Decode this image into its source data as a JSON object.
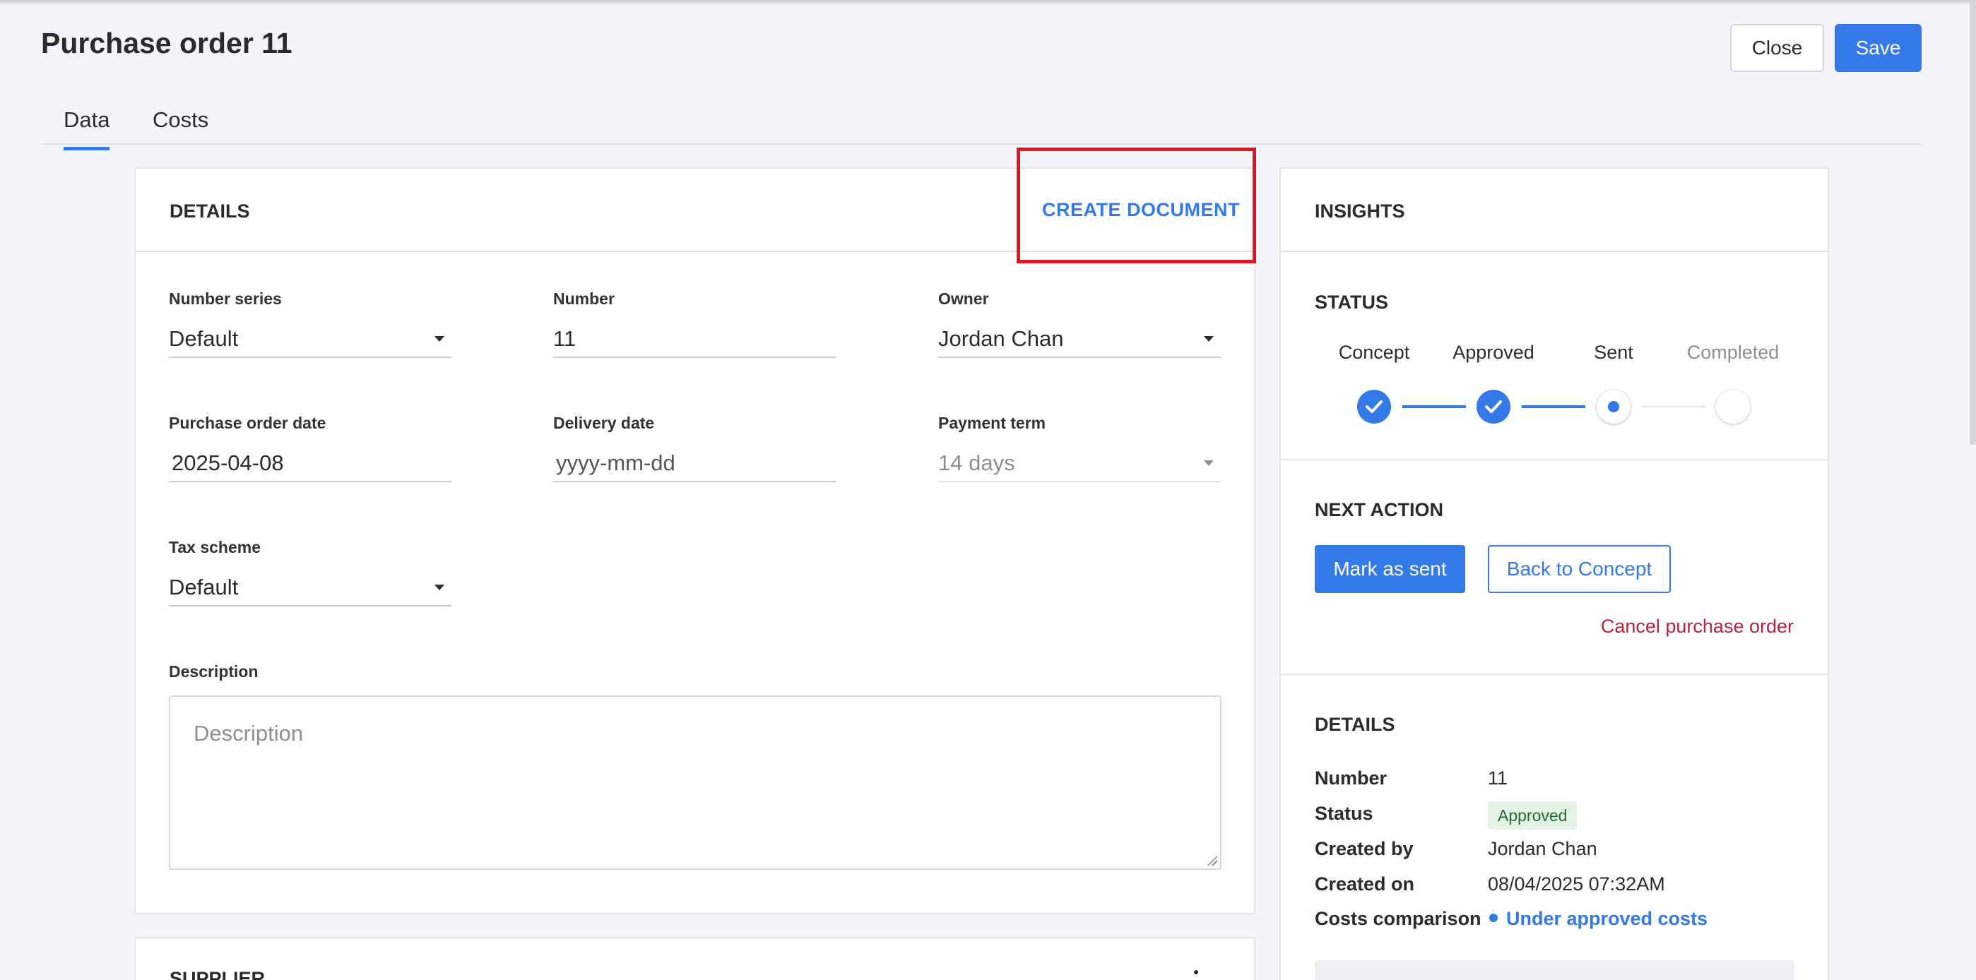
{
  "page": {
    "title": "Purchase order 11"
  },
  "header": {
    "close_label": "Close",
    "save_label": "Save"
  },
  "tabs": [
    {
      "label": "Data",
      "active": true
    },
    {
      "label": "Costs",
      "active": false
    }
  ],
  "details": {
    "title": "DETAILS",
    "create_document": "CREATE DOCUMENT",
    "number_series": {
      "label": "Number series",
      "value": "Default"
    },
    "number": {
      "label": "Number",
      "value": "11"
    },
    "owner": {
      "label": "Owner",
      "value": "Jordan Chan"
    },
    "purchase_order_date": {
      "label": "Purchase order date",
      "value": "2025-04-08"
    },
    "delivery_date": {
      "label": "Delivery date",
      "placeholder": "yyyy-mm-dd"
    },
    "payment_term": {
      "label": "Payment term",
      "value": "14 days"
    },
    "tax_scheme": {
      "label": "Tax scheme",
      "value": "Default"
    },
    "description": {
      "label": "Description",
      "placeholder": "Description"
    }
  },
  "supplier": {
    "title": "SUPPLIER"
  },
  "insights": {
    "title": "INSIGHTS",
    "status": {
      "title": "STATUS",
      "steps": [
        {
          "label": "Concept",
          "state": "done"
        },
        {
          "label": "Approved",
          "state": "done"
        },
        {
          "label": "Sent",
          "state": "current"
        },
        {
          "label": "Completed",
          "state": "todo"
        }
      ]
    },
    "next_action": {
      "title": "NEXT ACTION",
      "primary_label": "Mark as sent",
      "secondary_label": "Back to Concept",
      "cancel_label": "Cancel purchase order"
    },
    "details": {
      "title": "DETAILS",
      "number_key": "Number",
      "number_val": "11",
      "status_key": "Status",
      "status_val": "Approved",
      "created_by_key": "Created by",
      "created_by_val": "Jordan Chan",
      "created_on_key": "Created on",
      "created_on_val": "08/04/2025 07:32AM",
      "costs_key": "Costs comparison",
      "costs_val": "Under approved costs"
    }
  },
  "colors": {
    "accent": "#3479e8",
    "danger": "#b6223f",
    "highlight": "#e1141f",
    "badge_bg": "#e3f3e6"
  }
}
